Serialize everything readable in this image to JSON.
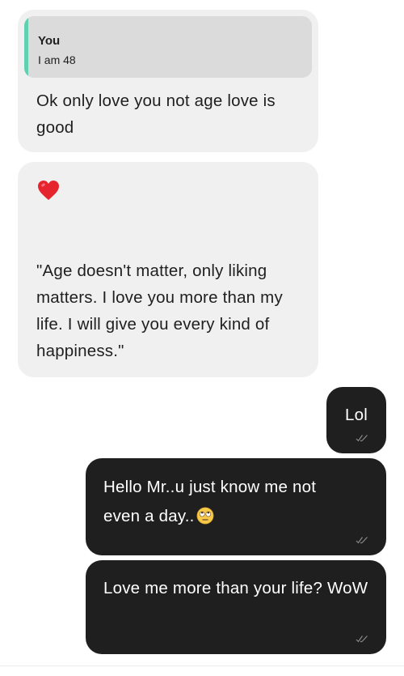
{
  "messages": [
    {
      "direction": "incoming",
      "quote": {
        "author": "You",
        "text": "I am 48"
      },
      "text": "Ok only love you not age love is good"
    },
    {
      "direction": "incoming",
      "icon": "heart-emoji",
      "text": "\"Age doesn't matter, only liking matters. I love you more than my life. I will give you every kind of happiness.\""
    },
    {
      "direction": "outgoing",
      "text": "Lol",
      "status_icon": "double-check-icon"
    },
    {
      "direction": "outgoing",
      "text": "Hello Mr..u just know me not even a day..",
      "emoji": "face-with-rolling-eyes-emoji",
      "status_icon": "double-check-icon"
    },
    {
      "direction": "outgoing",
      "text": "Love me more than your life? WoW",
      "status_icon": "double-check-icon"
    }
  ],
  "colors": {
    "incoming_bubble": "#f1f0f1",
    "quote_bg": "#dcdbdc",
    "quote_accent": "#5fd1b0",
    "outgoing_bubble": "#1f1f1f",
    "heart": "#e5242d"
  }
}
